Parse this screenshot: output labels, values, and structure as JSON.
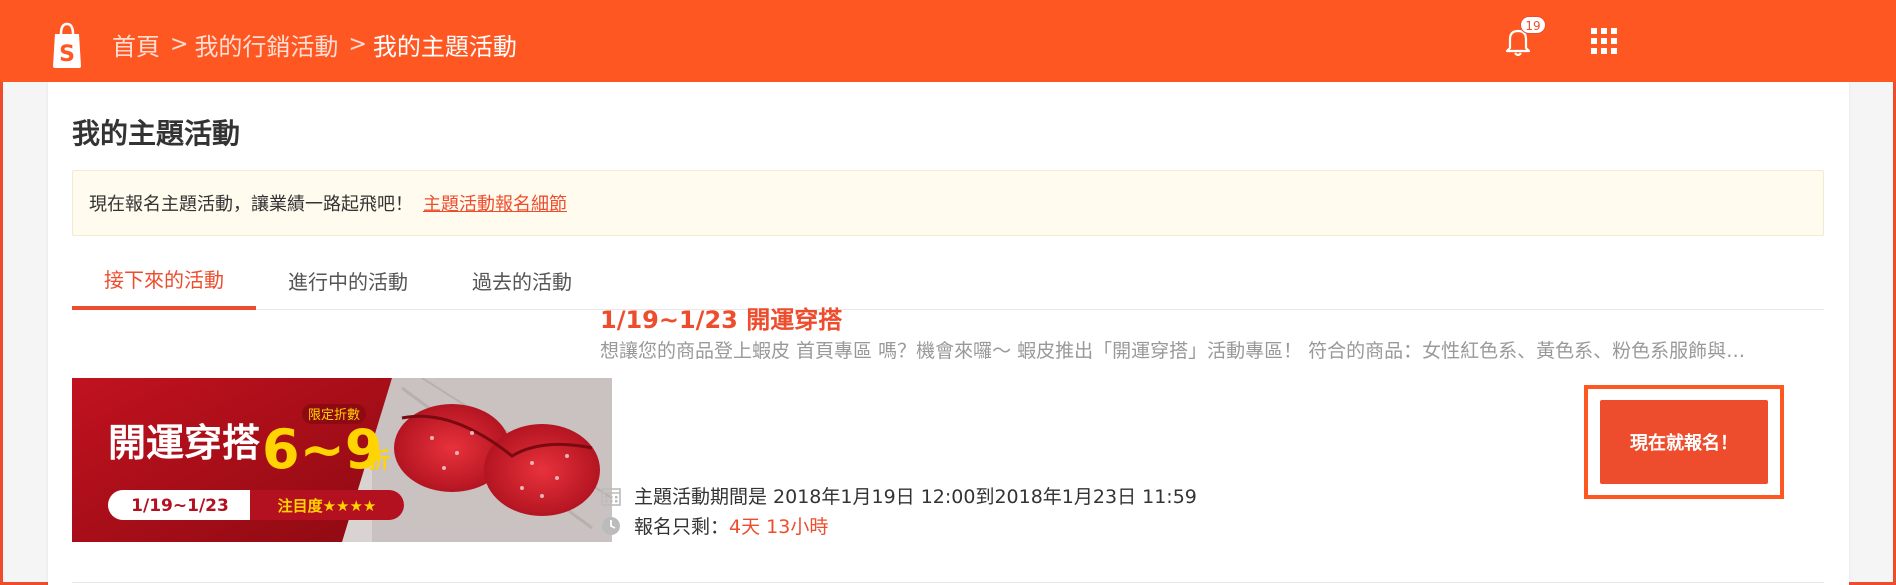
{
  "header": {
    "breadcrumbs": [
      "首頁",
      "我的行銷活動",
      "我的主題活動"
    ],
    "separator": ">",
    "notification_count": "19"
  },
  "page": {
    "title": "我的主題活動",
    "notice_text": "現在報名主題活動，讓業績一路起飛吧！",
    "notice_link": "主題活動報名細節"
  },
  "tabs": [
    {
      "label": "接下來的活動",
      "active": true
    },
    {
      "label": "進行中的活動",
      "active": false
    },
    {
      "label": "過去的活動",
      "active": false
    }
  ],
  "event": {
    "banner": {
      "headline": "開運穿搭",
      "discount_tag": "限定折數",
      "discount": "6~9",
      "discount_unit": "折",
      "dates": "1/19~1/23",
      "attention": "注目度★★★★"
    },
    "title": "1/19~1/23 開運穿搭",
    "description": "想讓您的商品登上蝦皮 首頁專區 嗎？機會來囉～  蝦皮推出「開運穿搭」活動專區！  符合的商品：女性紅色系、黃色系、粉色系服飾與配件",
    "period_text": "主題活動期間是 2018年1月19日 12:00到2018年1月23日 11:59",
    "remaining_label": "報名只剩：",
    "remaining_value": "4天 13小時",
    "join_label": "現在就報名！"
  },
  "colors": {
    "brand": "#ff5722",
    "accent": "#ee4d2d",
    "notice_bg": "#fffbee"
  }
}
